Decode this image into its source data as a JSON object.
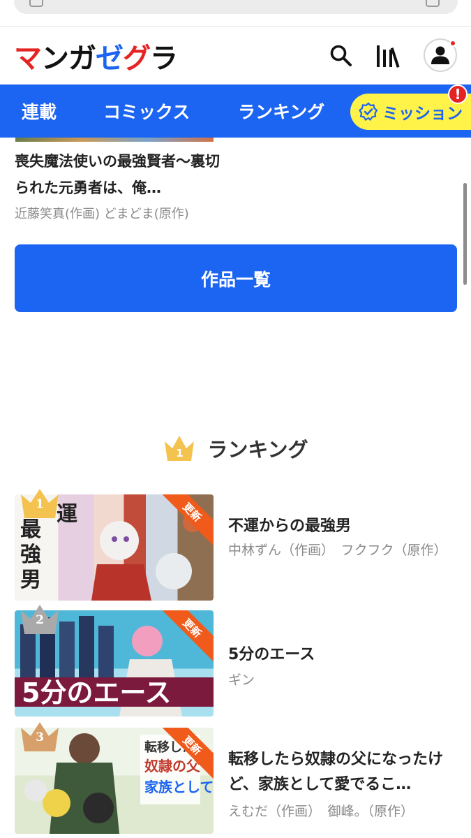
{
  "header": {
    "logo": [
      {
        "ch": "マ",
        "color": "#e52323"
      },
      {
        "ch": "ン",
        "color": "#111111"
      },
      {
        "ch": "ガ",
        "color": "#111111"
      },
      {
        "ch": "ゼ",
        "color": "#1c64f2"
      },
      {
        "ch": "グ",
        "color": "#e52323"
      },
      {
        "ch": "ラ",
        "color": "#111111"
      }
    ],
    "icons": [
      "search-icon",
      "library-icon",
      "user-icon"
    ]
  },
  "nav": {
    "items": [
      "連載",
      "コミックス",
      "ランキング"
    ],
    "mission_label": "ミッション",
    "mission_alert": "!"
  },
  "previous_item": {
    "title": "喪失魔法使いの最強賢者〜裏切られた元勇者は、俺…",
    "author": "近藤笑真(作画)  どまどま(原作)"
  },
  "list_button": "作品一覧",
  "ranking": {
    "heading": "ランキング",
    "heading_crown_number": "1",
    "items": [
      {
        "rank": "1",
        "badge": "更新",
        "title": "不運からの最強男",
        "author": "中林ずん（作画）　フクフク（原作）"
      },
      {
        "rank": "2",
        "badge": "更新",
        "title": "5分のエース",
        "author": "ギン"
      },
      {
        "rank": "3",
        "badge": "更新",
        "title": "転移したら奴隷の父になったけど、家族として愛でるこ…",
        "author": "えむだ（作画）　御峰。（原作）"
      }
    ]
  },
  "colors": {
    "brand_blue": "#1c64f2",
    "mission_yellow": "#fff34a",
    "alert_red": "#e52323",
    "badge_orange": "#f05a1a",
    "crown_gold": "#f3c24f",
    "crown_silver": "#a9a9a9",
    "crown_bronze": "#d7a06a"
  }
}
